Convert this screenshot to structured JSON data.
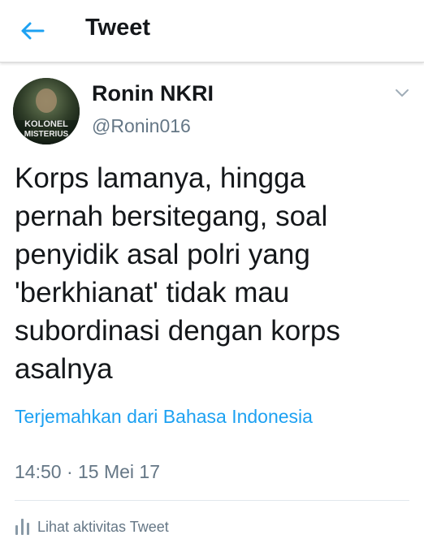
{
  "header": {
    "back_icon": "arrow-left-icon",
    "title": "Tweet"
  },
  "tweet": {
    "avatar": {
      "badge_line_1": "KOLONEL",
      "badge_line_2": "MISTERIUS"
    },
    "display_name": "Ronin NKRI",
    "handle": "@Ronin016",
    "menu_icon": "chevron-down-icon",
    "text": "Korps lamanya, hingga\npernah bersitegang, soal\npenyidik asal polri yang\n'berkhianat' tidak mau\nsubordinasi dengan korps\nasalnya",
    "translate_label": "Terjemahkan dari Bahasa Indonesia",
    "timestamp": "14:50 · 15 Mei 17",
    "activity_icon": "bar-chart-icon",
    "activity_label": "Lihat aktivitas Tweet"
  },
  "colors": {
    "accent": "#1da1f2",
    "text_primary": "#14171a",
    "text_secondary": "#657786",
    "divider": "#e1e8ed"
  }
}
